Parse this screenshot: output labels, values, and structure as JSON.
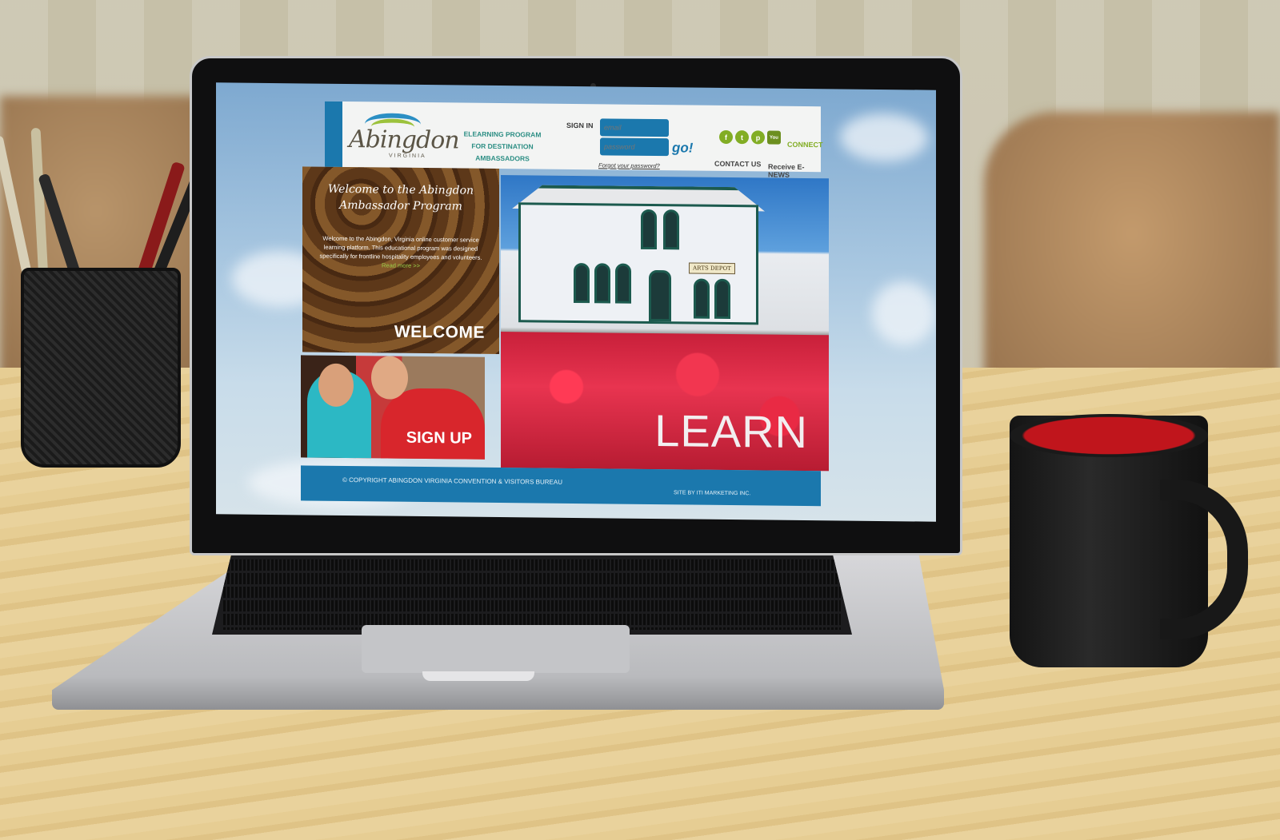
{
  "site": {
    "logo": {
      "name": "Abingdon",
      "sub": "VIRGINIA"
    },
    "header": {
      "program_line1": "ELEARNING PROGRAM",
      "program_line2": "FOR DESTINATION AMBASSADORS",
      "signin_label": "SIGN IN",
      "email_placeholder": "email",
      "password_placeholder": "password",
      "go_label": "go!",
      "forgot_label": "Forgot your password?",
      "connect_label": "CONNECT",
      "contact_label": "CONTACT US",
      "enews_label": "Receive E-NEWS",
      "social": [
        {
          "icon": "facebook-icon",
          "glyph": "f"
        },
        {
          "icon": "twitter-icon",
          "glyph": "t"
        },
        {
          "icon": "pinterest-icon",
          "glyph": "p"
        },
        {
          "icon": "youtube-icon",
          "glyph": "You"
        }
      ]
    },
    "welcome_tile": {
      "title_line1": "Welcome to the Abingdon",
      "title_line2": "Ambassador Program",
      "body": "Welcome to the Abingdon, Virginia online customer service learning platform. This educational program was designed specifically for frontline hospitality employees and volunteers.",
      "read_more": "Read more >>",
      "label": "WELCOME"
    },
    "signup_tile": {
      "label": "SIGN UP"
    },
    "learn_tile": {
      "label": "LEARN",
      "building_sign": "ARTS DEPOT"
    },
    "footer": {
      "copyright": "© COPYRIGHT ABINGDON VIRGINIA CONVENTION & VISITORS BUREAU",
      "credit": "SITE BY ITI MARKETING INC."
    }
  },
  "colors": {
    "brand_blue": "#1b78ad",
    "accent_green": "#82ad24",
    "program_teal": "#2c8e84"
  }
}
